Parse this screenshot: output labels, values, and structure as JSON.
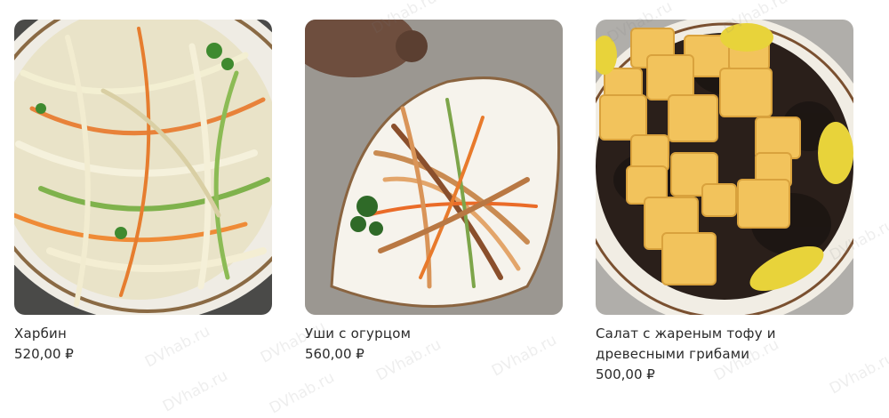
{
  "products": [
    {
      "name": "Харбин",
      "price": "520,00 ₽",
      "image": "cabbage-carrot-cucumber-salad-photo"
    },
    {
      "name": "Уши с огурцом",
      "price": "560,00 ₽",
      "image": "pork-ear-cucumber-salad-photo"
    },
    {
      "name": "Салат с жареным тофу и древесными грибами",
      "price": "500,00 ₽",
      "image": "fried-tofu-wood-ear-mushroom-salad-photo"
    }
  ],
  "watermark": "DVhab.ru",
  "colors": {
    "text": "#2a2a2a",
    "background": "#ffffff"
  }
}
